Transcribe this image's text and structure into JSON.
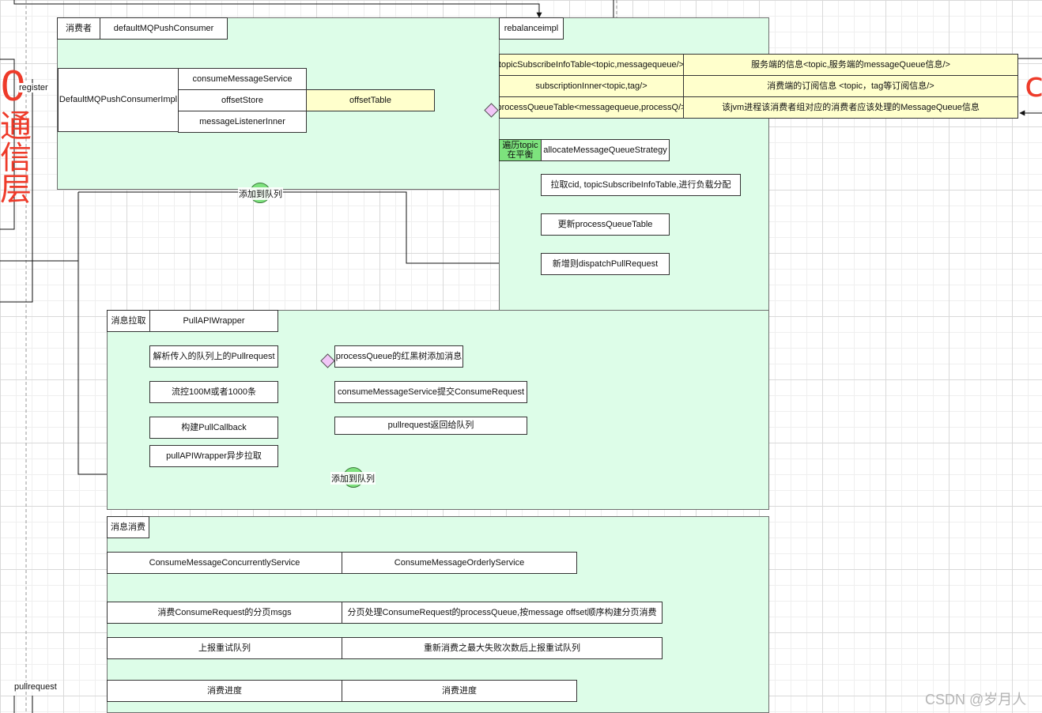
{
  "consumer": {
    "tag": "消费者",
    "name": "defaultMQPushConsumer",
    "impl": "DefaultMQPushConsumerImpl",
    "members": [
      "consumeMessageService",
      "offsetStore",
      "messageListenerInner"
    ],
    "offset_table": "offsetTable"
  },
  "rebalance": {
    "title": "rebalanceimpl",
    "tables": [
      {
        "key": "topicSubscribeInfoTable<topic,messagequeue/>",
        "desc": "服务端的信息<topic,服务端的messageQueue信息/>"
      },
      {
        "key": "subscriptionInner<topic,tag/>",
        "desc": "消费端的订阅信息 <topic，tag等订阅信息/>"
      },
      {
        "key": "processQueueTable<messagequeue,processQ/>",
        "desc": "该jvm进程该消费者组对应的消费者应该处理的MessageQueue信息"
      }
    ],
    "traverse_label": "遍历topic\n在平衡",
    "strategy": "allocateMessageQueueStrategy",
    "steps": [
      "拉取cid, topicSubscribeInfoTable,进行负载分配",
      "更新processQueueTable",
      "新增则dispatchPullRequest"
    ]
  },
  "pull": {
    "tag": "消息拉取",
    "name": "PullAPIWrapper",
    "left_steps": [
      "解析传入的队列上的Pullrequest",
      "流控100M或者1000条",
      "构建PullCallback",
      "pullAPIWrapper异步拉取"
    ],
    "right_steps": [
      "processQueue的红黑树添加消息",
      "consumeMessageService提交ConsumeRequest",
      "pullrequest返回给队列"
    ]
  },
  "consume": {
    "tag": "消息消费",
    "rows": [
      [
        "ConsumeMessageConcurrentlyService",
        "ConsumeMessageOrderlyService"
      ],
      [
        "消费ConsumeRequest的分页msgs",
        "分页处理ConsumeRequest的processQueue,按message offset顺序构建分页消费"
      ],
      [
        "上报重试队列",
        "重新消费之最大失败次数后上报重试队列"
      ],
      [
        "消费进度",
        "消费进度"
      ]
    ]
  },
  "queue_label": "添加到队列",
  "side": {
    "register": "register",
    "pullrequest": "pullrequest",
    "comm_layer": "通信层"
  },
  "watermark": "CSDN @岁月人"
}
